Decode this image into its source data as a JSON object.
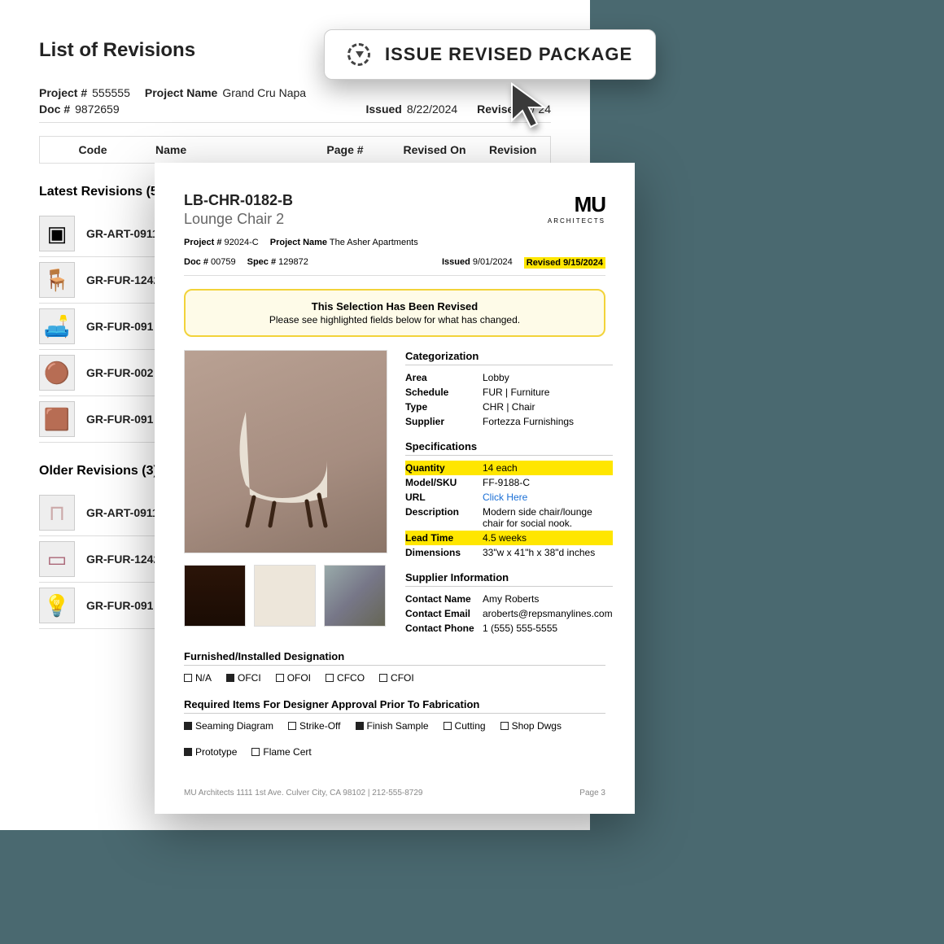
{
  "issueButton": {
    "label": "ISSUE REVISED PACKAGE"
  },
  "back": {
    "title": "List of Revisions",
    "meta": {
      "projNumLabel": "Project #",
      "projNum": "555555",
      "projNameLabel": "Project Name",
      "projName": "Grand Cru Napa",
      "docLabel": "Doc #",
      "doc": "9872659",
      "issuedLabel": "Issued",
      "issued": "8/22/2024",
      "revisedLabel": "Revised",
      "revised": "9/    24"
    },
    "cols": {
      "code": "Code",
      "name": "Name",
      "page": "Page #",
      "revon": "Revised On",
      "rev": "Revision"
    },
    "latestTitle": "Latest Revisions (5)",
    "latest": [
      {
        "code": "GR-ART-0911-",
        "icon": "frame"
      },
      {
        "code": "GR-FUR-1242-",
        "icon": "armchair"
      },
      {
        "code": "GR-FUR-091",
        "icon": "chair"
      },
      {
        "code": "GR-FUR-002",
        "icon": "tub-chair"
      },
      {
        "code": "GR-FUR-091",
        "icon": "side-table"
      }
    ],
    "olderTitle": "Older Revisions (3)",
    "older": [
      {
        "code": "GR-ART-0911-",
        "icon": "table"
      },
      {
        "code": "GR-FUR-1242-",
        "icon": "bench"
      },
      {
        "code": "GR-FUR-091",
        "icon": "lamp"
      }
    ]
  },
  "front": {
    "code": "LB-CHR-0182-B",
    "name": "Lounge Chair 2",
    "logo": {
      "top": "MU",
      "sub": "ARCHITECTS"
    },
    "meta": {
      "projNumLabel": "Project #",
      "projNum": "92024-C",
      "projNameLabel": "Project Name",
      "projName": "The Asher Apartments",
      "docLabel": "Doc #",
      "doc": "00759",
      "specLabel": "Spec #",
      "spec": "129872",
      "issuedLabel": "Issued",
      "issued": "9/01/2024",
      "revisedLabel": "Revised",
      "revised": "9/15/2024"
    },
    "callout": {
      "title": "This Selection Has Been Revised",
      "sub": "Please see highlighted fields below for what has changed."
    },
    "cat": {
      "heading": "Categorization",
      "areaK": "Area",
      "areaV": "Lobby",
      "schedK": "Schedule",
      "schedV": "FUR | Furniture",
      "typeK": "Type",
      "typeV": "CHR | Chair",
      "suppK": "Supplier",
      "suppV": "Fortezza Furnishings"
    },
    "spec": {
      "heading": "Specifications",
      "qtyK": "Quantity",
      "qtyV": "14 each",
      "skuK": "Model/SKU",
      "skuV": "FF-9188-C",
      "urlK": "URL",
      "urlV": "Click Here",
      "descK": "Description",
      "descV": "Modern side chair/lounge chair for social nook.",
      "leadK": "Lead Time",
      "leadV": "4.5 weeks",
      "dimK": "Dimensions",
      "dimV": "33\"w x 41\"h x 38\"d inches"
    },
    "supp": {
      "heading": "Supplier Information",
      "nameK": "Contact Name",
      "nameV": "Amy Roberts",
      "emailK": "Contact Email",
      "emailV": "aroberts@repsmanylines.com",
      "phoneK": "Contact Phone",
      "phoneV": "1 (555) 555-5555"
    },
    "fid": {
      "heading": "Furnished/Installed Designation",
      "opts": [
        {
          "label": "N/A",
          "checked": false
        },
        {
          "label": "OFCI",
          "checked": true
        },
        {
          "label": "OFOI",
          "checked": false
        },
        {
          "label": "CFCO",
          "checked": false
        },
        {
          "label": "CFOI",
          "checked": false
        }
      ]
    },
    "req": {
      "heading": "Required Items For Designer Approval Prior To Fabrication",
      "opts": [
        {
          "label": "Seaming Diagram",
          "checked": true
        },
        {
          "label": "Strike-Off",
          "checked": false
        },
        {
          "label": "Finish Sample",
          "checked": true
        },
        {
          "label": "Cutting",
          "checked": false
        },
        {
          "label": "Shop Dwgs",
          "checked": false
        },
        {
          "label": "Prototype",
          "checked": true
        },
        {
          "label": "Flame Cert",
          "checked": false
        }
      ]
    },
    "footer": {
      "left": "MU Architects  1111 1st Ave. Culver City, CA 98102    |    212-555-8729",
      "right": "Page 3"
    }
  }
}
